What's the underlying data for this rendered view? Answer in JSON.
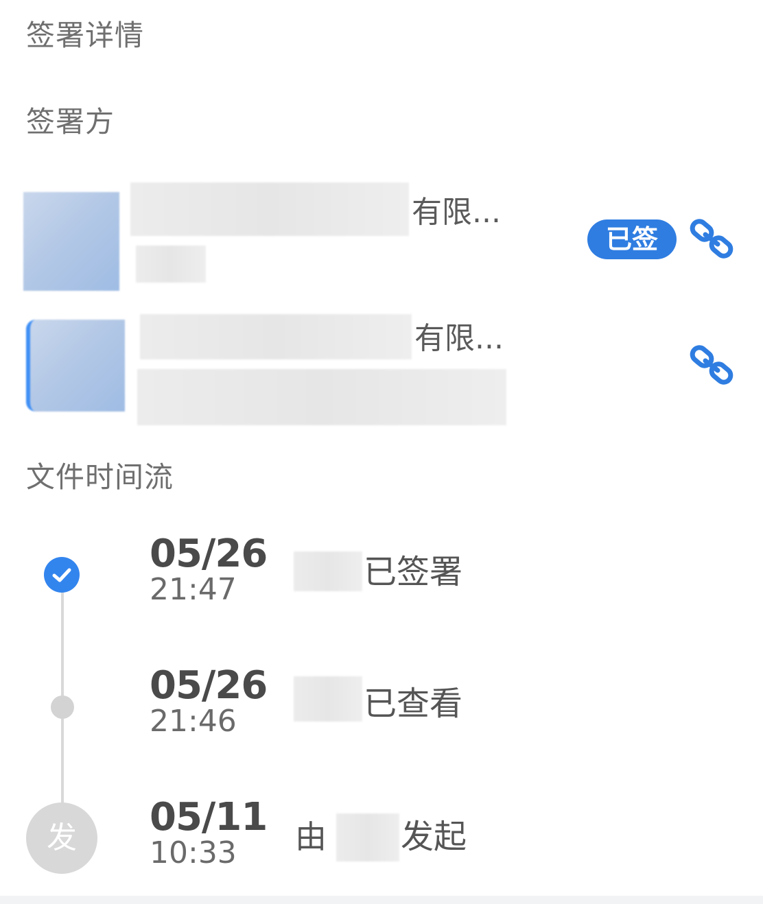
{
  "page_title": "签署详情",
  "signers_section": {
    "title": "签署方",
    "signers": [
      {
        "name_suffix": "有限...",
        "status_badge": "已签",
        "link_icon": "link-icon"
      },
      {
        "name_suffix": "有限...",
        "status_badge": "",
        "link_icon": "link-icon"
      }
    ]
  },
  "timeline_section": {
    "title": "文件时间流",
    "events": [
      {
        "date": "05/26",
        "time": "21:47",
        "prefix": "",
        "action": "已签署",
        "icon": "check-icon"
      },
      {
        "date": "05/26",
        "time": "21:46",
        "prefix": "",
        "action": "已查看",
        "icon": "dot-icon"
      },
      {
        "date": "05/11",
        "time": "10:33",
        "prefix": "由",
        "action": "发起",
        "icon_label": "发"
      }
    ]
  },
  "colors": {
    "accent": "#2f7de1",
    "timeline_line": "#d9d9d9",
    "muted_text": "#6f6f6f"
  }
}
